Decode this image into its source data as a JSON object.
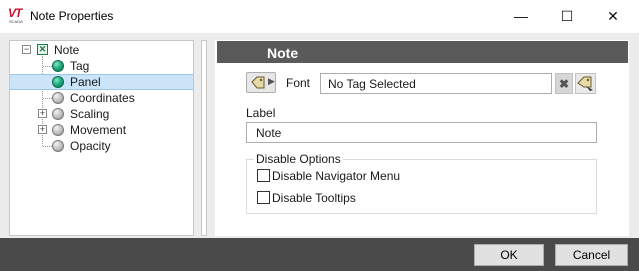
{
  "window": {
    "title": "Note Properties",
    "logo_text": "VT",
    "logo_subtext": "SCADA",
    "minimize_glyph": "—",
    "maximize_glyph": "☐",
    "close_glyph": "✕"
  },
  "tree": {
    "root": {
      "label": "Note",
      "expanded": true
    },
    "items": [
      {
        "label": "Tag",
        "status": "green",
        "expander": ""
      },
      {
        "label": "Panel",
        "status": "green",
        "expander": "",
        "selected": true
      },
      {
        "label": "Coordinates",
        "status": "gray",
        "expander": ""
      },
      {
        "label": "Scaling",
        "status": "gray",
        "expander": "+"
      },
      {
        "label": "Movement",
        "status": "gray",
        "expander": "+"
      },
      {
        "label": "Opacity",
        "status": "gray",
        "expander": ""
      }
    ]
  },
  "panel": {
    "header": "Note",
    "font_label": "Font",
    "font_value": "No Tag Selected",
    "clear_glyph": "✖",
    "label_caption": "Label",
    "label_value": "Note",
    "disable_group": {
      "title": "Disable Options",
      "options": [
        {
          "label": "Disable Navigator Menu",
          "checked": false
        },
        {
          "label": "Disable Tooltips",
          "checked": false
        }
      ]
    }
  },
  "footer": {
    "ok_label": "OK",
    "cancel_label": "Cancel"
  },
  "colors": {
    "header_bg": "#5a5a5a",
    "footer_bg": "#4a4a4a",
    "selection_bg": "#cce4f7",
    "status_green": "#18a377",
    "status_gray": "#bfbfbf",
    "logo_red": "#c8102e"
  }
}
